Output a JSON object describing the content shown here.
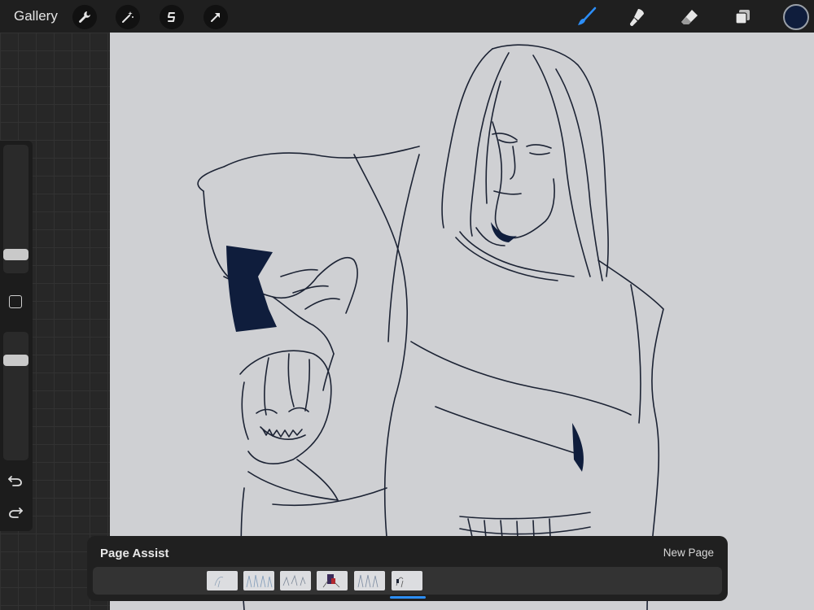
{
  "topbar": {
    "gallery_label": "Gallery",
    "left_tools": [
      "wrench-icon",
      "magic-wand-icon",
      "selection-icon",
      "transform-arrow-icon"
    ],
    "right_tools": [
      "brush-icon",
      "smudge-icon",
      "eraser-icon",
      "layers-icon"
    ],
    "active_tool": "brush-icon",
    "accent_color": "#2c8ef8",
    "current_color": "#0f1d3c"
  },
  "sidebar": {
    "brush_size_level": 0.15,
    "opacity_level": 0.85,
    "controls": [
      "modify-square-icon",
      "undo-icon",
      "redo-icon"
    ]
  },
  "page_assist": {
    "title": "Page Assist",
    "new_page_label": "New Page",
    "page_count": 6,
    "active_page": 6
  },
  "colors": {
    "canvas_bg": "#cfd0d3",
    "ink": "#1c2334",
    "fill": "#0f1d3c"
  }
}
